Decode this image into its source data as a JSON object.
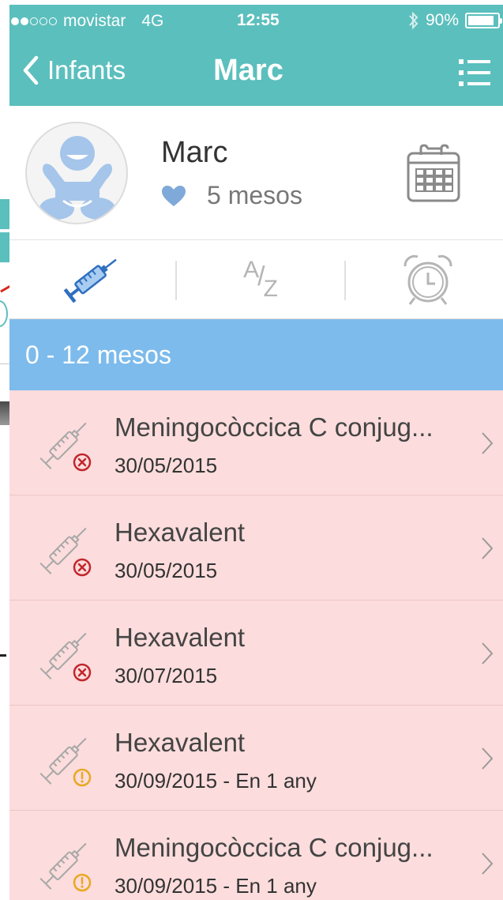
{
  "status_bar": {
    "carrier": "movistar",
    "network": "4G",
    "time": "12:55",
    "battery": "90%",
    "battery_level": 0.9,
    "signal_bars_filled": 2,
    "signal_bars_total": 5
  },
  "nav": {
    "back_label": "Infants",
    "title": "Marc"
  },
  "profile": {
    "name": "Marc",
    "age": "5 mesos"
  },
  "tabs": {
    "alphabetical_label_top": "A",
    "alphabetical_label_bottom": "Z"
  },
  "section": {
    "title": "0 - 12 mesos"
  },
  "vaccines": [
    {
      "title": "Meningocòccica C conjug...",
      "date": "30/05/2015",
      "status": "missed"
    },
    {
      "title": "Hexavalent",
      "date": "30/05/2015",
      "status": "missed"
    },
    {
      "title": "Hexavalent",
      "date": "30/07/2015",
      "status": "missed"
    },
    {
      "title": "Hexavalent",
      "date": "30/09/2015 - En 1 any",
      "status": "pending"
    },
    {
      "title": "Meningocòccica C conjug...",
      "date": "30/09/2015 - En 1 any",
      "status": "pending"
    }
  ],
  "colors": {
    "brand_teal": "#5bbfbd",
    "section_blue": "#7dbbec",
    "row_pink": "#fcdcdc",
    "missed_red": "#c0272d",
    "pending_amber": "#e9a820",
    "heart_blue": "#7fa9d8"
  },
  "icons": {
    "back": "chevron-left-icon",
    "menu": "list-menu-icon",
    "calendar": "calendar-icon",
    "vaccines_tab": "syringe-icon",
    "alarm_tab": "alarm-clock-icon",
    "missed_status": "x-circle-icon",
    "pending_status": "exclamation-circle-icon",
    "row_chevron": "chevron-right-icon"
  }
}
